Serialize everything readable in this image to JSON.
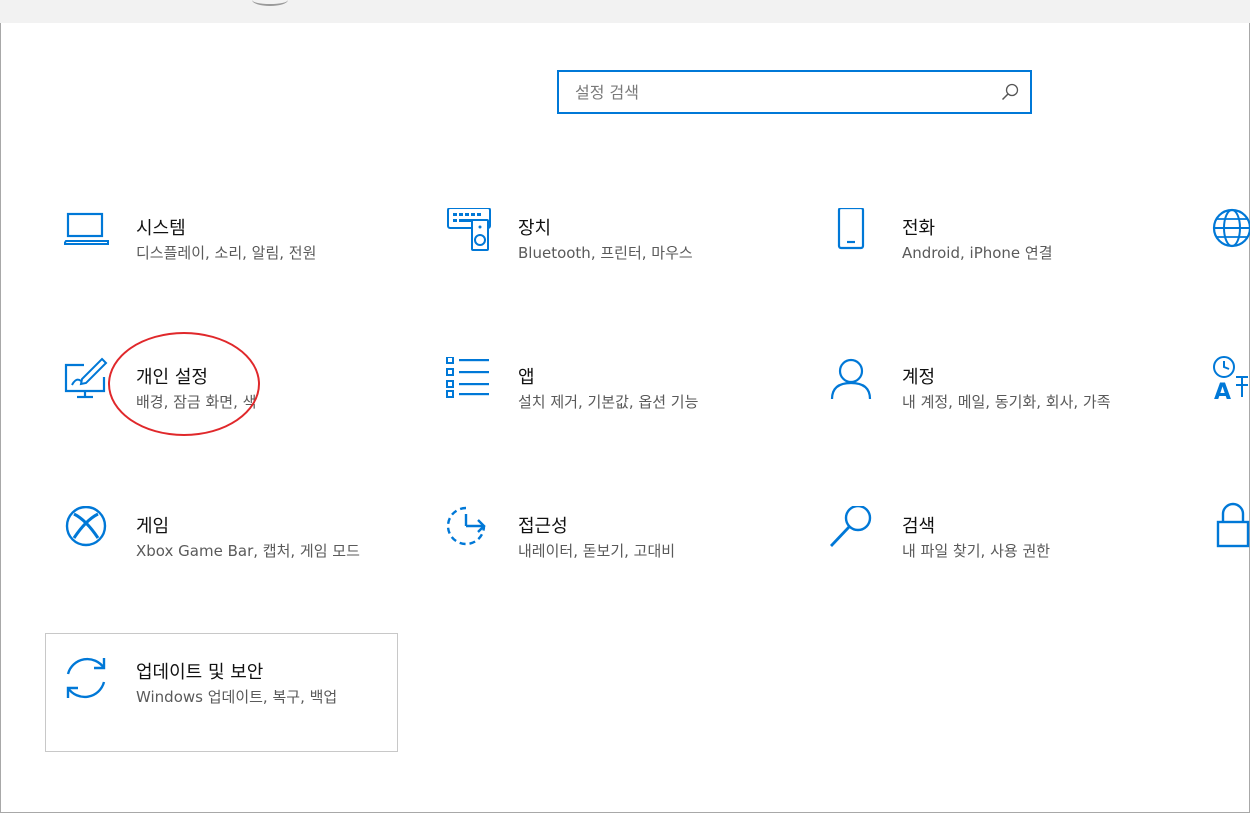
{
  "search": {
    "placeholder": "설정 검색",
    "icon": "search-icon"
  },
  "accent_color": "#0078d7",
  "annotation_color": "#e0282b",
  "tiles": [
    {
      "title": "시스템",
      "desc": "디스플레이, 소리, 알림, 전원",
      "icon": "laptop-icon"
    },
    {
      "title": "장치",
      "desc": "Bluetooth, 프린터, 마우스",
      "icon": "devices-icon"
    },
    {
      "title": "전화",
      "desc": "Android, iPhone 연결",
      "icon": "phone-icon"
    },
    {
      "title": "개인 설정",
      "desc": "배경, 잠금 화면, 색",
      "icon": "personalization-icon"
    },
    {
      "title": "앱",
      "desc": "설치 제거, 기본값, 옵션 기능",
      "icon": "apps-icon"
    },
    {
      "title": "계정",
      "desc": "내 계정, 메일, 동기화, 회사, 가족",
      "icon": "account-icon"
    },
    {
      "title": "게임",
      "desc": "Xbox Game Bar, 캡처, 게임 모드",
      "icon": "xbox-icon"
    },
    {
      "title": "접근성",
      "desc": "내레이터, 돋보기, 고대비",
      "icon": "ease-of-access-icon"
    },
    {
      "title": "검색",
      "desc": "내 파일 찾기, 사용 권한",
      "icon": "search-icon"
    },
    {
      "title": "업데이트 및 보안",
      "desc": "Windows 업데이트, 복구, 백업",
      "icon": "update-icon"
    }
  ],
  "partial_icons": [
    "globe-icon",
    "language-icon",
    "lock-icon"
  ]
}
